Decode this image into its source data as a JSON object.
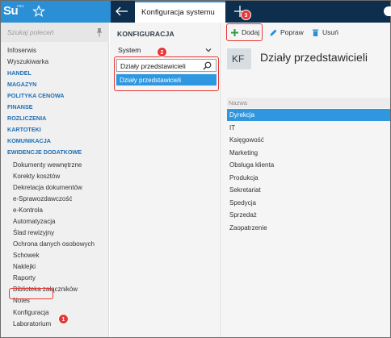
{
  "app": {
    "logo_text": "Su",
    "logo_sub": "PRO"
  },
  "tab": {
    "title": "Konfiguracja systemu"
  },
  "sidebar": {
    "search_placeholder": "Szukaj poleceń",
    "items": [
      {
        "label": "Infoserwis",
        "type": "plain"
      },
      {
        "label": "Wyszukiwarka",
        "type": "plain"
      },
      {
        "label": "HANDEL",
        "type": "group"
      },
      {
        "label": "MAGAZYN",
        "type": "group"
      },
      {
        "label": "POLITYKA CENOWA",
        "type": "group"
      },
      {
        "label": "FINANSE",
        "type": "group"
      },
      {
        "label": "ROZLICZENIA",
        "type": "group"
      },
      {
        "label": "KARTOTEKI",
        "type": "group"
      },
      {
        "label": "KOMUNIKACJA",
        "type": "group"
      },
      {
        "label": "EWIDENCJE DODATKOWE",
        "type": "group"
      },
      {
        "label": "Dokumenty wewnętrzne",
        "type": "sub"
      },
      {
        "label": "Korekty kosztów",
        "type": "sub"
      },
      {
        "label": "Dekretacja dokumentów",
        "type": "sub"
      },
      {
        "label": "e-Sprawozdawczość",
        "type": "sub"
      },
      {
        "label": "e-Kontrola",
        "type": "sub"
      },
      {
        "label": "Automatyzacja",
        "type": "sub"
      },
      {
        "label": "Ślad rewizyjny",
        "type": "sub"
      },
      {
        "label": "Ochrona danych osobowych",
        "type": "sub"
      },
      {
        "label": "Schowek",
        "type": "sub"
      },
      {
        "label": "Naklejki",
        "type": "sub"
      },
      {
        "label": "Raporty",
        "type": "sub"
      },
      {
        "label": "Biblioteka załączników",
        "type": "sub"
      },
      {
        "label": "Notes",
        "type": "sub"
      },
      {
        "label": "Konfiguracja",
        "type": "sub"
      },
      {
        "label": "Laboratorium",
        "type": "sub"
      }
    ]
  },
  "middle": {
    "title": "KONFIGURACJA",
    "selector_value": "System",
    "search_value": "Działy przedstawicieli",
    "result": "Działy przedstawicieli"
  },
  "toolbar": {
    "add_label": "Dodaj",
    "edit_label": "Popraw",
    "delete_label": "Usuń"
  },
  "main": {
    "badge": "KF",
    "title": "Działy przedstawicieli",
    "column_header": "Nazwa",
    "rows": [
      "Dyrekcja",
      "IT",
      "Księgowość",
      "Marketing",
      "Obsługa klienta",
      "Produkcja",
      "Sekretariat",
      "Spedycja",
      "Sprzedaż",
      "Zaopatrzenie"
    ],
    "selected_row": 0
  },
  "callouts": [
    "1",
    "2",
    "3"
  ],
  "colors": {
    "brand_blue": "#2b8fd6",
    "dark_bar": "#0e2e4d",
    "selection": "#2e97e0",
    "group_label": "#1f6fb5",
    "highlight": "#e53935"
  },
  "icons": {
    "star": "star-icon",
    "back": "back-arrow-icon",
    "new_tab": "plus-icon",
    "search": "search-icon",
    "pin": "pin-icon",
    "add": "plus-icon",
    "edit": "pencil-icon",
    "delete": "trash-icon"
  }
}
